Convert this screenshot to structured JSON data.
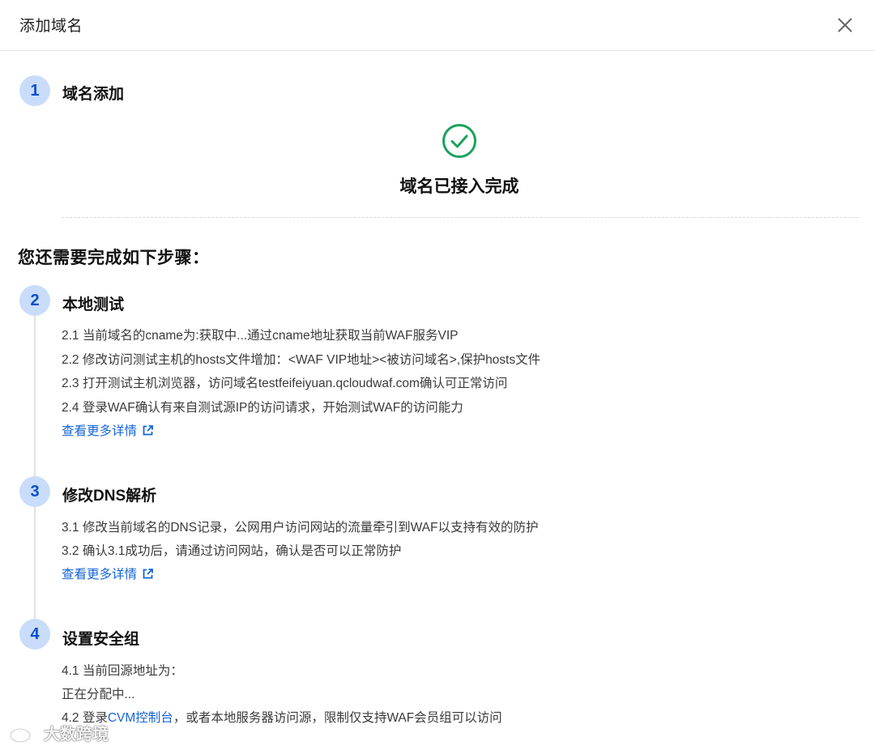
{
  "dialog": {
    "title": "添加域名",
    "close_icon": "close-icon"
  },
  "step1": {
    "number": "1",
    "title": "域名添加",
    "success_icon": "check-circle-icon",
    "success_color": "#1aa35b",
    "success_text": "域名已接入完成"
  },
  "remaining_heading": "您还需要完成如下步骤：",
  "step2": {
    "number": "2",
    "title": "本地测试",
    "lines": [
      "2.1 当前域名的cname为:获取中...通过cname地址获取当前WAF服务VIP",
      "2.2 修改访问测试主机的hosts文件增加：<WAF VIP地址><被访问域名>,保护hosts文件",
      "2.3 打开测试主机浏览器，访问域名testfeifeiyuan.qcloudwaf.com确认可正常访问",
      "2.4 登录WAF确认有来自测试源IP的访问请求，开始测试WAF的访问能力"
    ],
    "more_link": "查看更多详情"
  },
  "step3": {
    "number": "3",
    "title": "修改DNS解析",
    "lines": [
      "3.1 修改当前域名的DNS记录，公网用户访问网站的流量牵引到WAF以支持有效的防护",
      "3.2 确认3.1成功后，请通过访问网站，确认是否可以正常防护"
    ],
    "more_link": "查看更多详情"
  },
  "step4": {
    "number": "4",
    "title": "设置安全组",
    "line1": "4.1 当前回源地址为：",
    "line2": "正在分配中...",
    "line3_prefix": "4.2 登录",
    "line3_link": "CVM控制台",
    "line3_suffix": "，或者本地服务器访问源，限制仅支持WAF会员组可以访问"
  },
  "watermark": {
    "text": "大数跨境",
    "icon": "weibo-logo-icon"
  },
  "colors": {
    "accent": "#1665d8",
    "badge_bg": "#c9dcfa",
    "badge_text": "#0a4fc9",
    "success": "#1aa35b"
  }
}
